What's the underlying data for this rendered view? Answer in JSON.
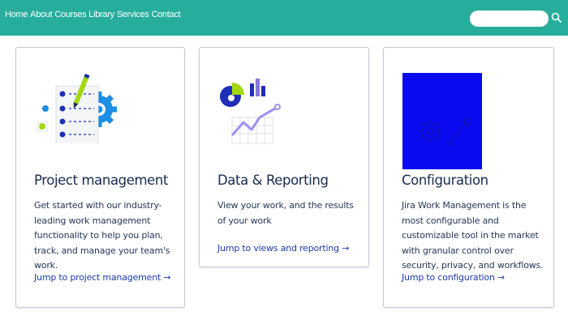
{
  "nav": {
    "items": [
      "Home",
      "About",
      "Courses",
      "Library",
      "Services",
      "Contact"
    ]
  },
  "search": {
    "placeholder": "",
    "value": "",
    "icon": "search-icon"
  },
  "colors": {
    "topbar": "#27ad9c",
    "link": "#1e3aa8",
    "title": "#172b4d",
    "config_illustration": "#0a0af0"
  },
  "cards": [
    {
      "title": "Project management",
      "description": "Get started with our industry-leading work management functionality to help you plan, track, and manage your team's work.",
      "link": "Jump to project management →",
      "illustration": "checklist-gear-illustration"
    },
    {
      "title": "Data & Reporting",
      "description": "View your work, and the results of your work",
      "link": "Jump to views and reporting →",
      "illustration": "charts-illustration"
    },
    {
      "title": "Configuration",
      "description": "Jira Work Management is the most configurable and customizable tool in the market with granular control over security, privacy, and workflows.",
      "link": "Jump to configuration →",
      "illustration": "gears-illustration"
    }
  ]
}
